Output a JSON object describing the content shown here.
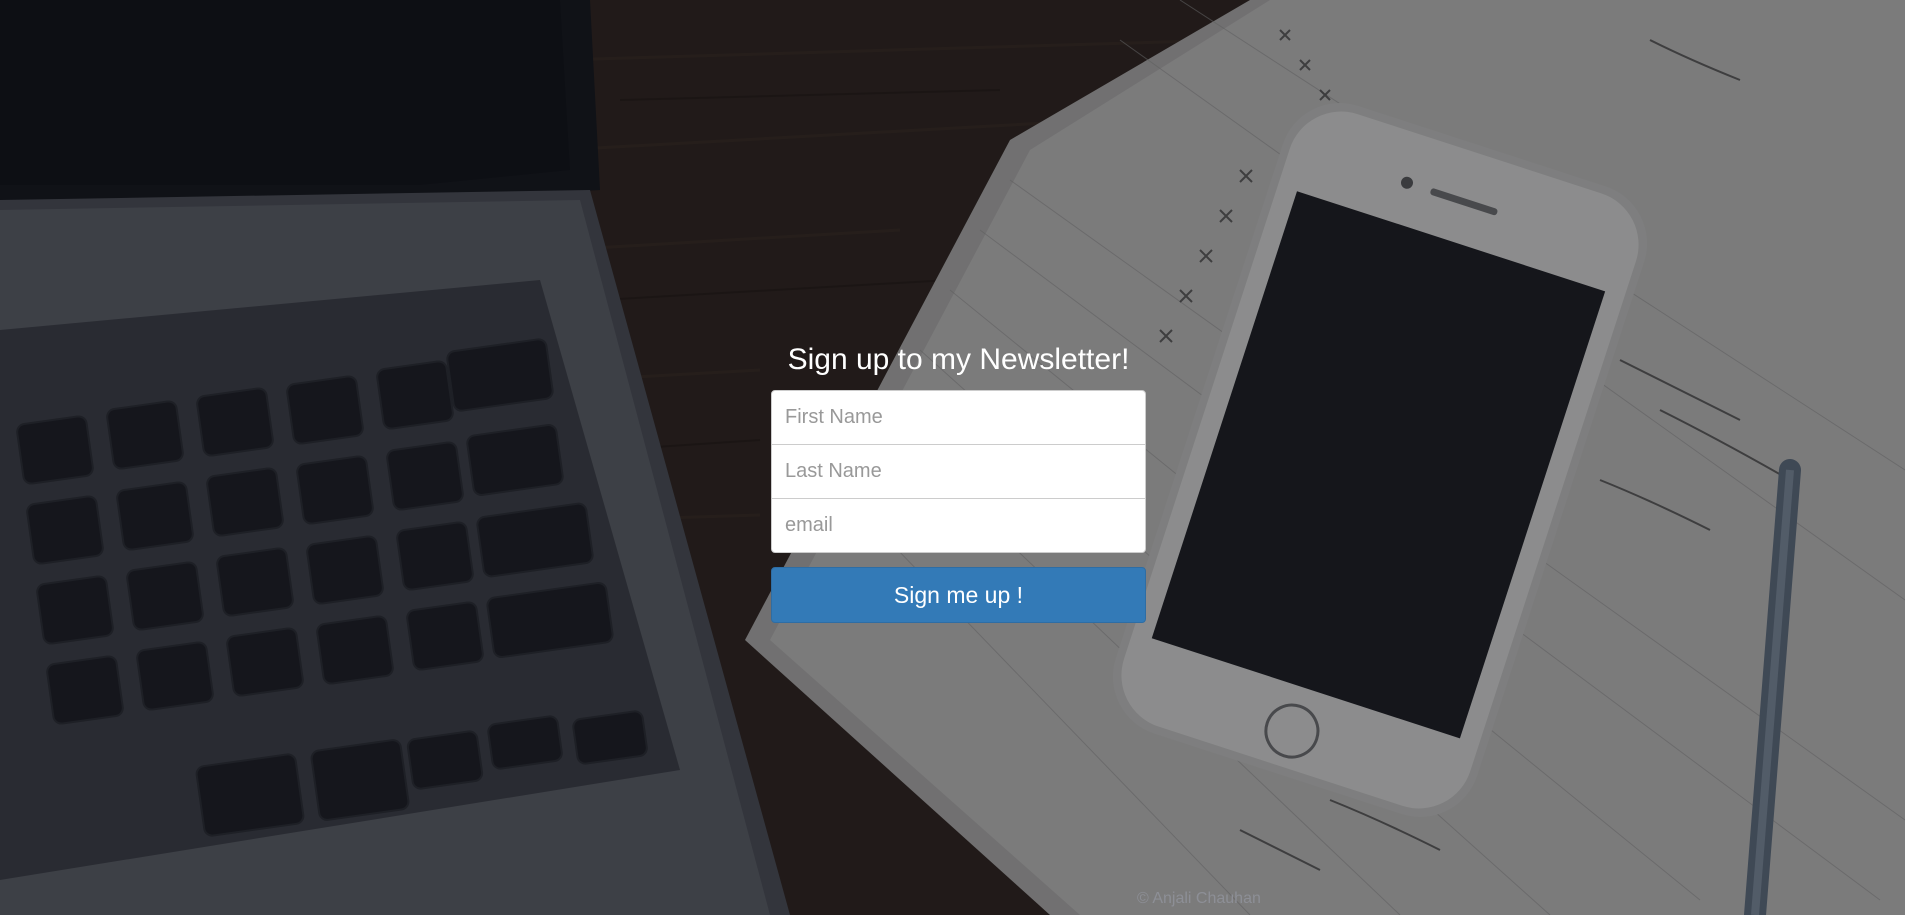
{
  "signup": {
    "title": "Sign up to my Newsletter!",
    "first_name_placeholder": "First Name",
    "last_name_placeholder": "Last Name",
    "email_placeholder": "email",
    "submit_label": "Sign me up !"
  },
  "footer": {
    "copyright": "© Anjali Chauhan"
  },
  "colors": {
    "button": "#337ab7",
    "title_text": "#ffffff",
    "footer_text": "#8d8f96"
  }
}
